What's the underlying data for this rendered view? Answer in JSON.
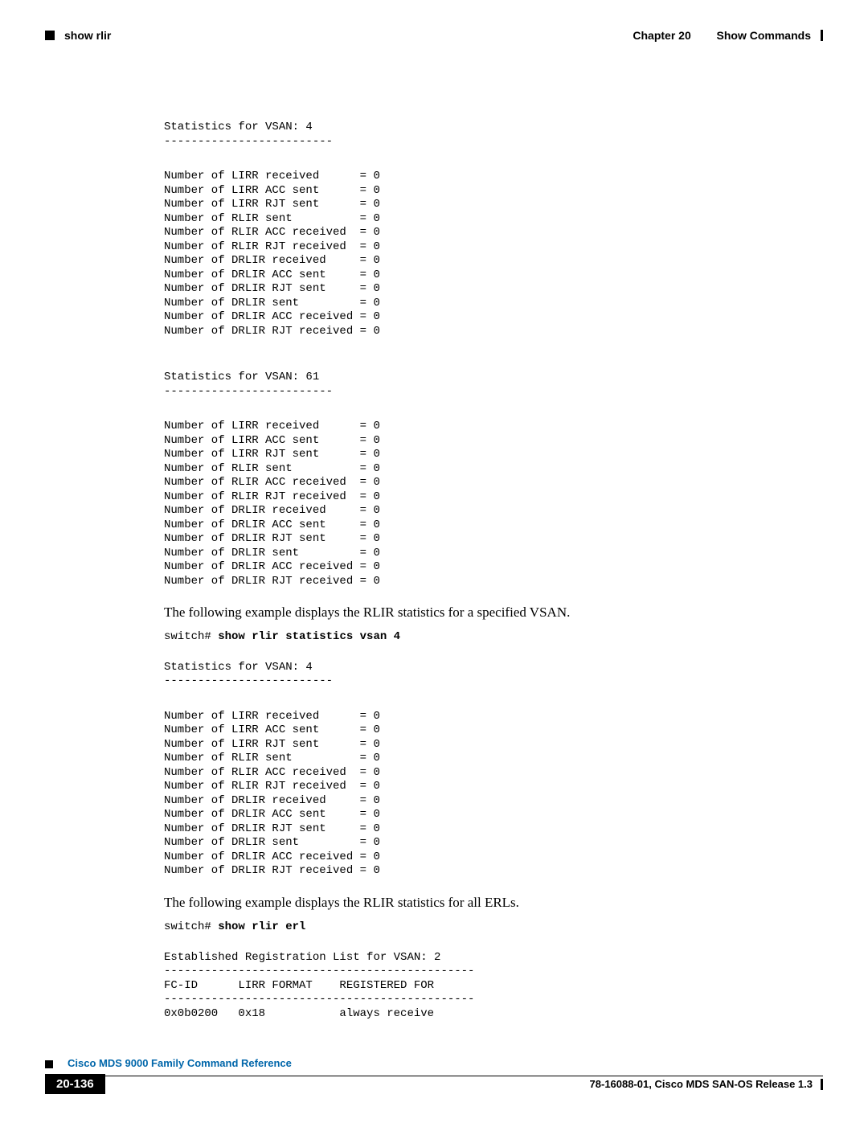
{
  "header": {
    "left_label": "show rlir",
    "right_chapter": "Chapter 20",
    "right_title": "Show Commands"
  },
  "stat_blocks": {
    "block1_header": "Statistics for VSAN: 4\n-------------------------",
    "block2_header": "Statistics for VSAN: 61\n-------------------------",
    "block3_header": "Statistics for VSAN: 4\n-------------------------",
    "stat_lines": "Number of LIRR received      = 0\nNumber of LIRR ACC sent      = 0\nNumber of LIRR RJT sent      = 0\nNumber of RLIR sent          = 0\nNumber of RLIR ACC received  = 0\nNumber of RLIR RJT received  = 0\nNumber of DRLIR received     = 0\nNumber of DRLIR ACC sent     = 0\nNumber of DRLIR RJT sent     = 0\nNumber of DRLIR sent         = 0\nNumber of DRLIR ACC received = 0\nNumber of DRLIR RJT received = 0"
  },
  "body_text": {
    "para1": "The following example displays the RLIR statistics for a specified VSAN.",
    "para2": "The following example displays the RLIR statistics for all ERLs."
  },
  "prompts": {
    "switch_prefix": "switch# ",
    "cmd1": "show rlir statistics vsan 4",
    "cmd2": "show rlir erl"
  },
  "erl_block": "Established Registration List for VSAN: 2\n----------------------------------------------\nFC-ID      LIRR FORMAT    REGISTERED FOR\n----------------------------------------------\n0x0b0200   0x18           always receive",
  "footer": {
    "title": "Cisco MDS 9000 Family Command Reference",
    "page": "20-136",
    "release": "78-16088-01, Cisco MDS SAN-OS Release 1.3"
  }
}
